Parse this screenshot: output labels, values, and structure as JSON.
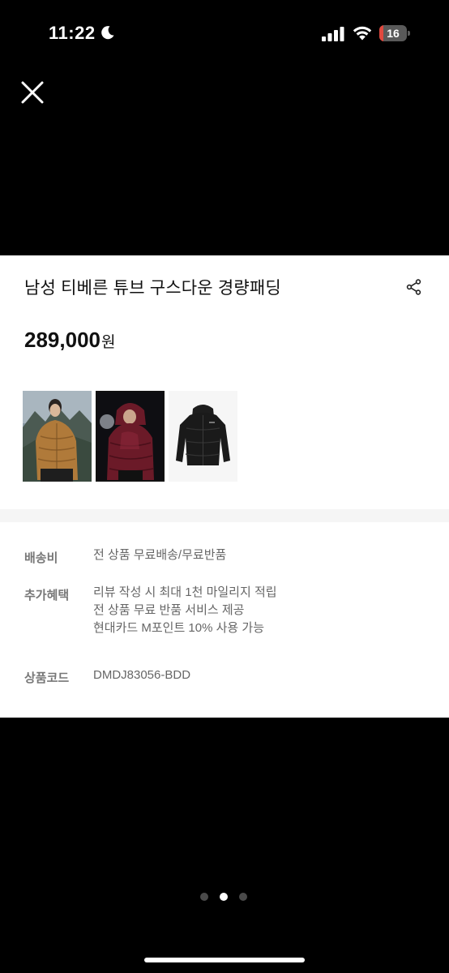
{
  "status_bar": {
    "time": "11:22",
    "battery_level": "16",
    "battery_fraction": 0.16,
    "icons": [
      "moon-icon",
      "signal-icon",
      "wifi-icon",
      "battery-icon"
    ],
    "battery_color": "#e0483e"
  },
  "top_bar": {
    "close_icon": "close-icon"
  },
  "product": {
    "title": "남성 티베른 튜브 구스다운 경량패딩",
    "price_amount": "289,000",
    "price_currency": "원",
    "share_icon": "share-icon",
    "thumbnails": [
      {
        "name": "camel-jacket-photo",
        "color": "#b07a3a"
      },
      {
        "name": "burgundy-jacket-photo",
        "color": "#6b1a28"
      },
      {
        "name": "black-jacket-photo",
        "color": "#1a1a1a"
      }
    ]
  },
  "info": {
    "shipping": {
      "label": "배송비",
      "values": [
        "전 상품 무료배송/무료반품"
      ]
    },
    "benefits": {
      "label": "추가혜택",
      "values": [
        "리뷰 작성 시 최대 1천 마일리지 적립",
        "전 상품 무료 반품 서비스 제공",
        "현대카드 M포인트 10% 사용 가능"
      ]
    },
    "code": {
      "label": "상품코드",
      "values": [
        "DMDJ83056-BDD"
      ]
    }
  },
  "pager": {
    "count": 3,
    "active_index": 1
  }
}
